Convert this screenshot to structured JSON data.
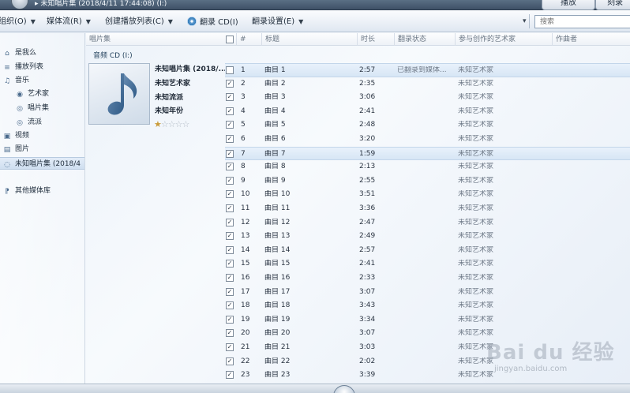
{
  "titlebar": {
    "breadcrumb": "▸ 未知唱片集 (2018/4/11 17:44:08) (I:)",
    "buttons": [
      "播放",
      "刻录"
    ]
  },
  "toolbar": {
    "organize": "组织(O)",
    "stream": "媒体流(R)",
    "create_playlist": "创建播放列表(C)",
    "rip_cd": "翻录 CD(I)",
    "rip_settings": "翻录设置(E)",
    "search_placeholder": "搜索"
  },
  "sidebar": {
    "items": [
      {
        "label": "是我么",
        "icon": "user-icon"
      },
      {
        "label": "播放列表",
        "icon": "playlist-icon"
      },
      {
        "label": "音乐",
        "icon": "music-note-icon"
      },
      {
        "label": "艺术家",
        "icon": "artist-icon"
      },
      {
        "label": "唱片集",
        "icon": "album-icon"
      },
      {
        "label": "流派",
        "icon": "genre-icon"
      },
      {
        "label": "视频",
        "icon": "video-icon"
      },
      {
        "label": "图片",
        "icon": "picture-icon"
      },
      {
        "label": "未知唱片集 (2018/4",
        "icon": "cd-icon",
        "selected": true
      },
      {
        "label": "其他媒体库",
        "icon": "other-library-icon"
      }
    ]
  },
  "columns": {
    "album": "唱片集",
    "number": "#",
    "title": "标题",
    "length": "时长",
    "rip_status": "翻录状态",
    "contributing_artist": "参与创作的艺术家",
    "composer": "作曲者"
  },
  "group": {
    "label": "音频 CD (I:)",
    "album_title": "未知唱片集 (2018/...",
    "artist": "未知艺术家",
    "genre": "未知流派",
    "year": "未知年份",
    "rating_stars": 1,
    "rating_max": 5
  },
  "tracks": [
    {
      "num": "1",
      "checked": false,
      "title": "曲目 1",
      "length": "2:57",
      "status": "已翻录到媒体...",
      "artist": "未知艺术家",
      "selected": true
    },
    {
      "num": "2",
      "checked": true,
      "title": "曲目 2",
      "length": "2:35",
      "status": "",
      "artist": "未知艺术家"
    },
    {
      "num": "3",
      "checked": true,
      "title": "曲目 3",
      "length": "3:06",
      "status": "",
      "artist": "未知艺术家"
    },
    {
      "num": "4",
      "checked": true,
      "title": "曲目 4",
      "length": "2:41",
      "status": "",
      "artist": "未知艺术家"
    },
    {
      "num": "5",
      "checked": true,
      "title": "曲目 5",
      "length": "2:48",
      "status": "",
      "artist": "未知艺术家"
    },
    {
      "num": "6",
      "checked": true,
      "title": "曲目 6",
      "length": "3:20",
      "status": "",
      "artist": "未知艺术家"
    },
    {
      "num": "7",
      "checked": true,
      "title": "曲目 7",
      "length": "1:59",
      "status": "",
      "artist": "未知艺术家",
      "selected": true
    },
    {
      "num": "8",
      "checked": true,
      "title": "曲目 8",
      "length": "2:13",
      "status": "",
      "artist": "未知艺术家"
    },
    {
      "num": "9",
      "checked": true,
      "title": "曲目 9",
      "length": "2:55",
      "status": "",
      "artist": "未知艺术家"
    },
    {
      "num": "10",
      "checked": true,
      "title": "曲目 10",
      "length": "3:51",
      "status": "",
      "artist": "未知艺术家"
    },
    {
      "num": "11",
      "checked": true,
      "title": "曲目 11",
      "length": "3:36",
      "status": "",
      "artist": "未知艺术家"
    },
    {
      "num": "12",
      "checked": true,
      "title": "曲目 12",
      "length": "2:47",
      "status": "",
      "artist": "未知艺术家"
    },
    {
      "num": "13",
      "checked": true,
      "title": "曲目 13",
      "length": "2:49",
      "status": "",
      "artist": "未知艺术家"
    },
    {
      "num": "14",
      "checked": true,
      "title": "曲目 14",
      "length": "2:57",
      "status": "",
      "artist": "未知艺术家"
    },
    {
      "num": "15",
      "checked": true,
      "title": "曲目 15",
      "length": "2:41",
      "status": "",
      "artist": "未知艺术家"
    },
    {
      "num": "16",
      "checked": true,
      "title": "曲目 16",
      "length": "2:33",
      "status": "",
      "artist": "未知艺术家"
    },
    {
      "num": "17",
      "checked": true,
      "title": "曲目 17",
      "length": "3:07",
      "status": "",
      "artist": "未知艺术家"
    },
    {
      "num": "18",
      "checked": true,
      "title": "曲目 18",
      "length": "3:43",
      "status": "",
      "artist": "未知艺术家"
    },
    {
      "num": "19",
      "checked": true,
      "title": "曲目 19",
      "length": "3:34",
      "status": "",
      "artist": "未知艺术家"
    },
    {
      "num": "20",
      "checked": true,
      "title": "曲目 20",
      "length": "3:07",
      "status": "",
      "artist": "未知艺术家"
    },
    {
      "num": "21",
      "checked": true,
      "title": "曲目 21",
      "length": "3:03",
      "status": "",
      "artist": "未知艺术家"
    },
    {
      "num": "22",
      "checked": true,
      "title": "曲目 22",
      "length": "2:02",
      "status": "",
      "artist": "未知艺术家"
    },
    {
      "num": "23",
      "checked": true,
      "title": "曲目 23",
      "length": "3:39",
      "status": "",
      "artist": "未知艺术家"
    }
  ],
  "watermark": {
    "brand": "Bai du 经验",
    "url": "jingyan.baidu.com"
  }
}
